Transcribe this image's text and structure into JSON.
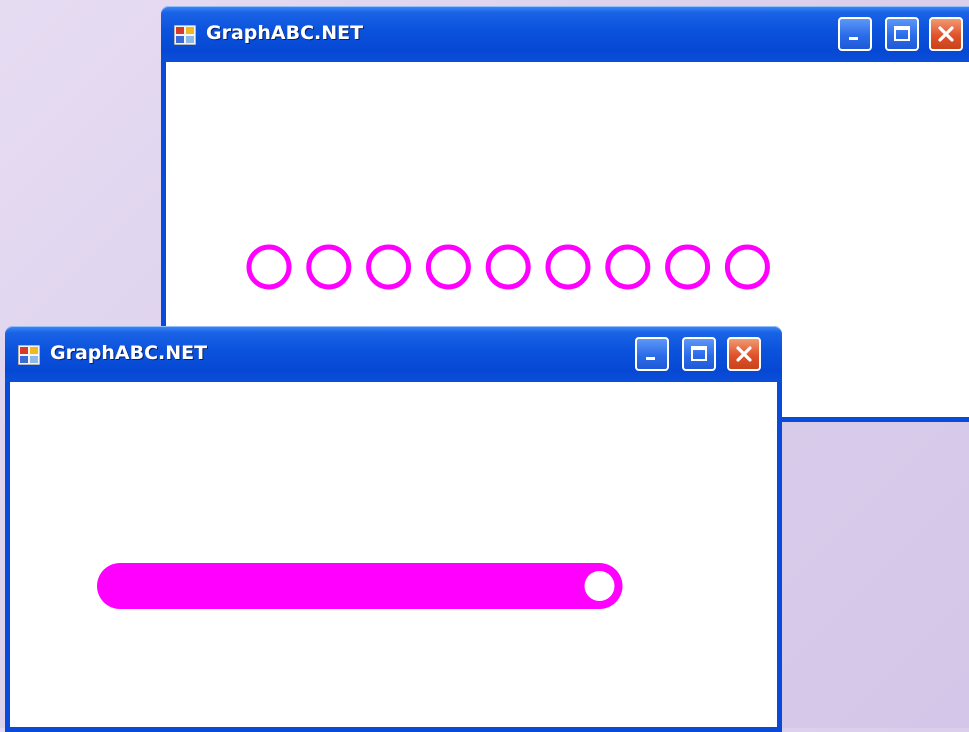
{
  "windows": {
    "top": {
      "title": "GraphABC.NET",
      "icon": "app-icon",
      "controls": [
        "minimize-icon",
        "maximize-icon",
        "close-icon"
      ],
      "circle_count": 9
    },
    "bottom": {
      "title": "GraphABC.NET",
      "icon": "app-icon",
      "controls": [
        "minimize-icon",
        "maximize-icon",
        "close-icon"
      ],
      "progress": 0.93
    }
  },
  "colors": {
    "shape": "#ff00ff",
    "client_background": "#ffffff",
    "titlebar": "#0a52dc",
    "close_button": "#e0522a"
  }
}
